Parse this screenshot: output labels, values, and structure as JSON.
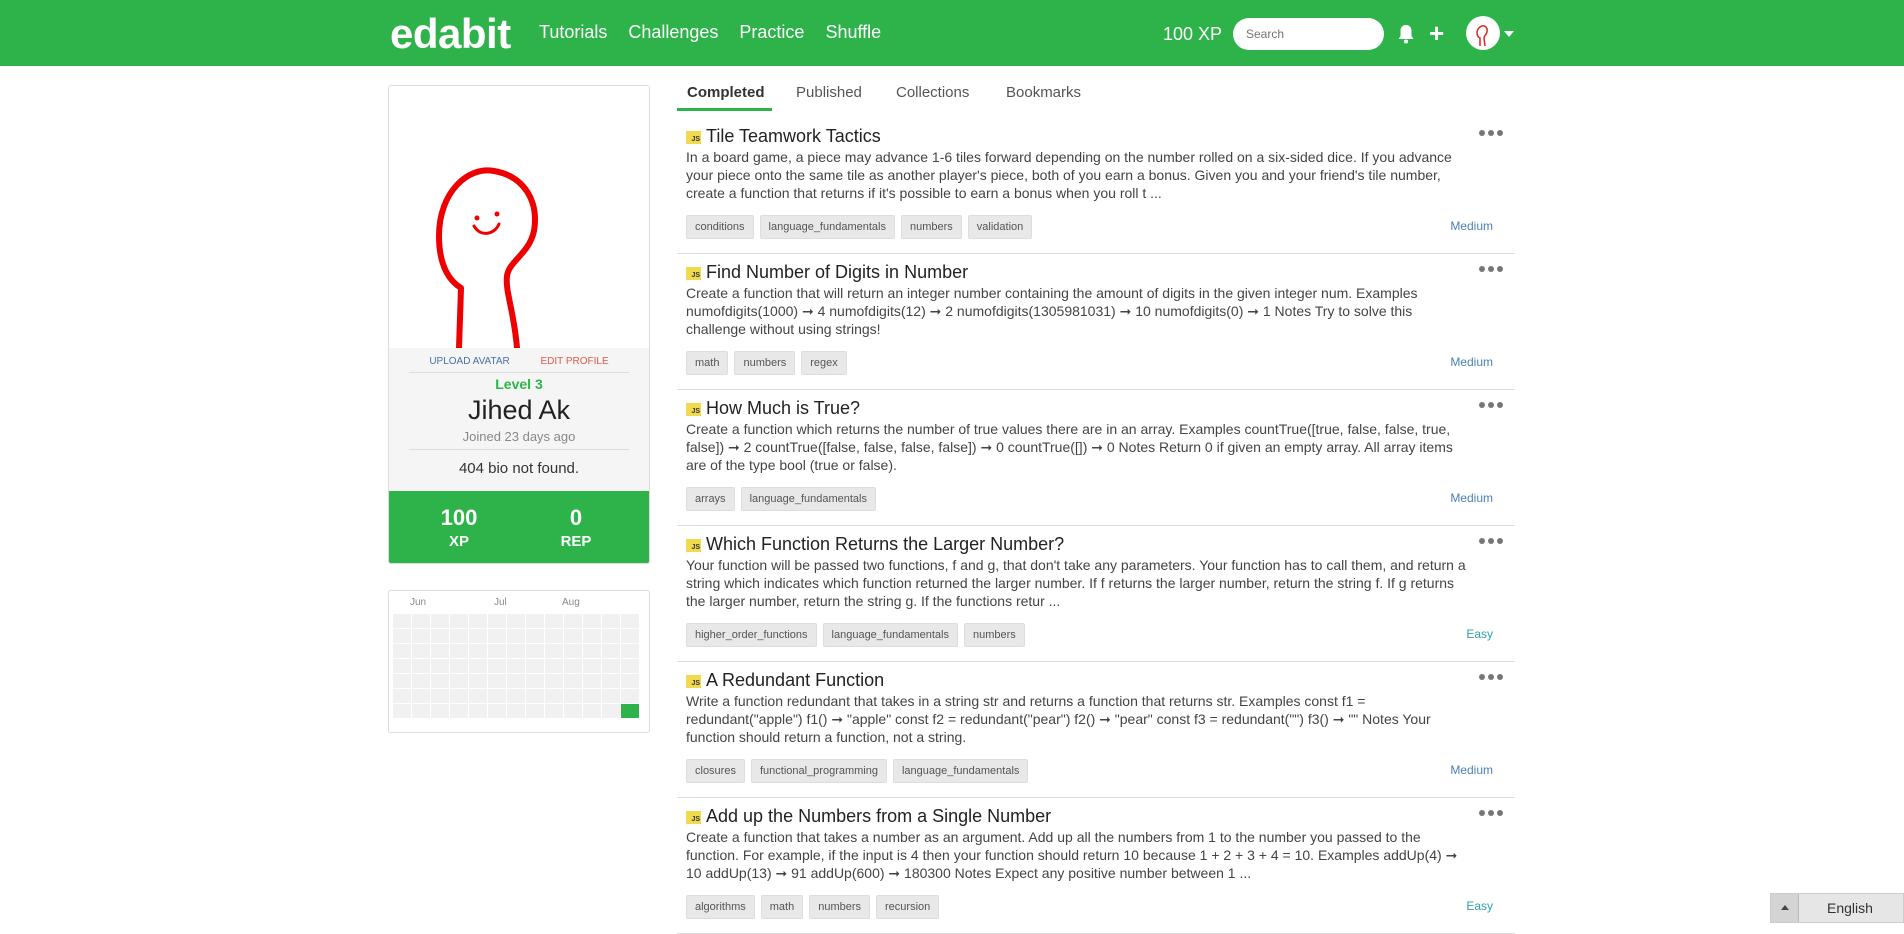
{
  "header": {
    "logo": "edabit",
    "nav": [
      "Tutorials",
      "Challenges",
      "Practice",
      "Shuffle"
    ],
    "xp": "100 XP",
    "search_placeholder": "Search",
    "bell_icon": "bell-icon",
    "plus_icon": "plus-icon"
  },
  "profile": {
    "upload_avatar": "UPLOAD AVATAR",
    "edit_profile": "EDIT PROFILE",
    "level": "Level 3",
    "name": "Jihed Ak",
    "joined": "Joined 23 days ago",
    "bio": "404 bio not found.",
    "xp_value": "100",
    "xp_label": "XP",
    "rep_value": "0",
    "rep_label": "REP"
  },
  "activity": {
    "months": [
      "Jun",
      "Jul",
      "Aug"
    ],
    "active_cells": 1
  },
  "tabs": [
    "Completed",
    "Published",
    "Collections",
    "Bookmarks"
  ],
  "challenges": [
    {
      "language": "JS",
      "title": "Tile Teamwork Tactics",
      "description": "In a board game, a piece may advance 1-6 tiles forward depending on the number rolled on a six-sided dice. If you advance your piece onto the same tile as another player's piece, both of you earn a bonus. Given you and your friend's tile number, create a function that returns if it's possible to earn a bonus when you roll t ...",
      "tags": [
        "conditions",
        "language_fundamentals",
        "numbers",
        "validation"
      ],
      "difficulty": "Medium"
    },
    {
      "language": "JS",
      "title": "Find Number of Digits in Number",
      "description": "Create a function that will return an integer number containing the amount of digits in the given integer num. Examples numofdigits(1000) ➞ 4 numofdigits(12) ➞ 2 numofdigits(1305981031) ➞ 10 numofdigits(0) ➞ 1 Notes Try to solve this challenge without using strings!",
      "tags": [
        "math",
        "numbers",
        "regex"
      ],
      "difficulty": "Medium"
    },
    {
      "language": "JS",
      "title": "How Much is True?",
      "description": "Create a function which returns the number of true values there are in an array. Examples countTrue([true, false, false, true, false]) ➞ 2 countTrue([false, false, false, false]) ➞ 0 countTrue([]) ➞ 0 Notes Return 0 if given an empty array. All array items are of the type bool (true or false).",
      "tags": [
        "arrays",
        "language_fundamentals"
      ],
      "difficulty": "Medium"
    },
    {
      "language": "JS",
      "title": "Which Function Returns the Larger Number?",
      "description": "Your function will be passed two functions, f and g, that don't take any parameters. Your function has to call them, and return a string which indicates which function returned the larger number. If f returns the larger number, return the string f. If g returns the larger number, return the string g. If the functions retur ...",
      "tags": [
        "higher_order_functions",
        "language_fundamentals",
        "numbers"
      ],
      "difficulty": "Easy"
    },
    {
      "language": "JS",
      "title": "A Redundant Function",
      "description": "Write a function redundant that takes in a string str and returns a function that returns str. Examples const f1 = redundant(\"apple\") f1() ➞ \"apple\" const f2 = redundant(\"pear\") f2() ➞ \"pear\" const f3 = redundant(\"\") f3() ➞ \"\" Notes Your function should return a function, not a string.",
      "tags": [
        "closures",
        "functional_programming",
        "language_fundamentals"
      ],
      "difficulty": "Medium"
    },
    {
      "language": "JS",
      "title": "Add up the Numbers from a Single Number",
      "description": "Create a function that takes a number as an argument. Add up all the numbers from 1 to the number you passed to the function. For example, if the input is 4 then your function should return 10 because 1 + 2 + 3 + 4 = 10. Examples addUp(4) ➞ 10 addUp(13) ➞ 91 addUp(600) ➞ 180300 Notes Expect any positive number between 1 ...",
      "tags": [
        "algorithms",
        "math",
        "numbers",
        "recursion"
      ],
      "difficulty": "Easy"
    }
  ],
  "language_selector": "English",
  "colors": {
    "brand_green": "#2db34a",
    "medium": "#4a7fb5",
    "easy": "#2ba3a3"
  }
}
